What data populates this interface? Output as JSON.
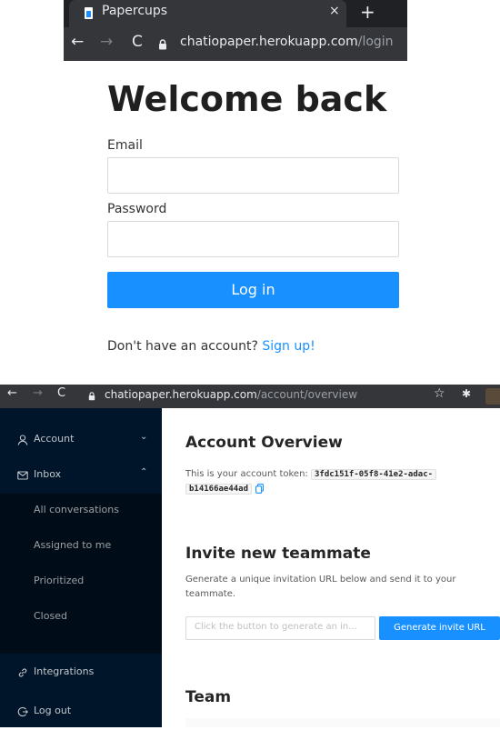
{
  "browser_top": {
    "tab_title": "Papercups",
    "close_glyph": "×",
    "new_tab_glyph": "+",
    "back_glyph": "←",
    "forward_glyph": "→",
    "reload_glyph": "C",
    "url_host": "chatiopaper.herokuapp.com",
    "url_path": "/login"
  },
  "login": {
    "title": "Welcome back",
    "email_label": "Email",
    "password_label": "Password",
    "submit_label": "Log in",
    "signup_prompt": "Don't have an account?",
    "signup_link": "Sign up!"
  },
  "browser_bottom": {
    "back_glyph": "←",
    "forward_glyph": "→",
    "reload_glyph": "C",
    "url_host": "chatiopaper.herokuapp.com",
    "url_path": "/account/overview",
    "star_glyph": "☆",
    "extensions_glyph": "✱"
  },
  "sidebar": {
    "account": {
      "label": "Account",
      "caret": "⌄",
      "icon": "user-icon"
    },
    "inbox": {
      "label": "Inbox",
      "caret": "⌃",
      "icon": "mail-icon"
    },
    "inbox_items": [
      "All conversations",
      "Assigned to me",
      "Prioritized",
      "Closed"
    ],
    "integrations": {
      "label": "Integrations",
      "icon": "link-icon"
    },
    "logout": {
      "label": "Log out",
      "icon": "logout-icon"
    }
  },
  "overview": {
    "title": "Account Overview",
    "token_text": "This is your account token:",
    "token_part1": "3fdc151f-05f8-41e2-adac-",
    "token_part2": "b14166ae44ad",
    "invite_title": "Invite new teammate",
    "invite_description_line1": "Generate a unique invitation URL below and send it to your",
    "invite_description_line2": "teammate.",
    "invite_placeholder": "Click the button to generate an in...",
    "invite_button": "Generate invite URL",
    "team_title": "Team"
  },
  "colors": {
    "primary": "#1890ff",
    "sidebar_bg": "#001529",
    "submenu_bg": "#000c17",
    "chrome_dark": "#202124",
    "chrome_toolbar": "#35363a"
  }
}
